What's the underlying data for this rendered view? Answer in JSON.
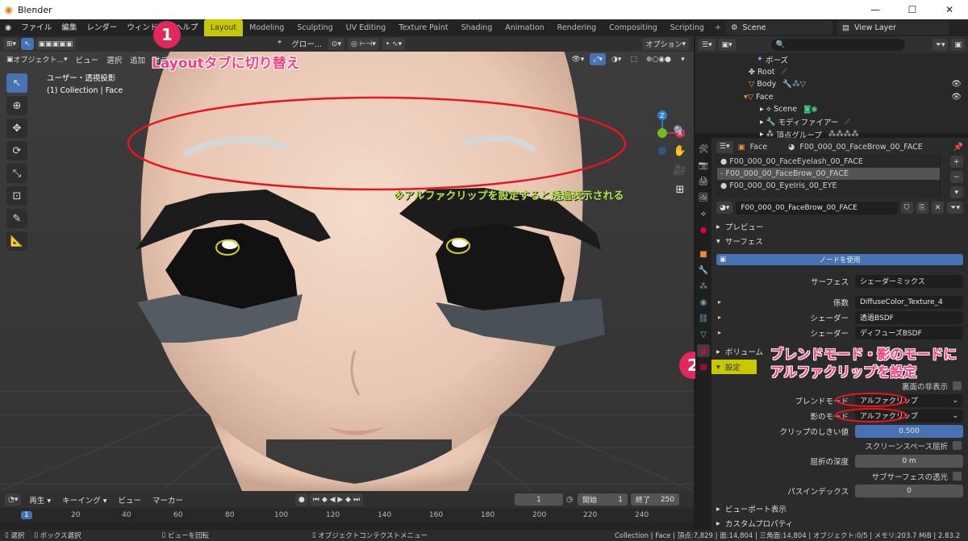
{
  "window": {
    "title": "Blender",
    "min": "—",
    "max": "☐",
    "close": "✕"
  },
  "menu": [
    "ファイル",
    "編集",
    "レンダー",
    "ウィンドウ",
    "ヘルプ"
  ],
  "workspaces": [
    "Layout",
    "Modeling",
    "Sculpting",
    "UV Editing",
    "Texture Paint",
    "Shading",
    "Animation",
    "Rendering",
    "Compositing",
    "Scripting"
  ],
  "scene": {
    "name": "Scene",
    "view_layer": "View Layer"
  },
  "viewport": {
    "header": {
      "mode": "オブジェクト...",
      "view": "ビュー",
      "select": "選択",
      "add": "追加",
      "object": "オブジェクト"
    },
    "header2": {
      "transform": "グロー...",
      "options": "オプション"
    },
    "info_line1": "ユーザー・透視投影",
    "info_line2": "(1) Collection | Face",
    "gizmo": {
      "z": "Z",
      "x": "X",
      "y": "Y"
    }
  },
  "annotations": {
    "step1_num": "1",
    "step1_text": "Layoutタブに切り替え",
    "note": "※アルファクリップを設定すると透過表示される",
    "step2_num": "2",
    "step2_line1": "ブレンドモード・影のモードに",
    "step2_line2": "アルファクリップを設定"
  },
  "outliner": {
    "rows": [
      {
        "label": "ポーズ",
        "indent": 5
      },
      {
        "label": "Root",
        "indent": 4
      },
      {
        "label": "Body",
        "indent": 4
      },
      {
        "label": "Face",
        "indent": 4
      },
      {
        "label": "Scene",
        "indent": 5
      },
      {
        "label": "モディファイアー",
        "indent": 5
      },
      {
        "label": "頂点グループ",
        "indent": 5
      }
    ]
  },
  "properties": {
    "object": "Face",
    "material_name": "F00_000_00_FaceBrow_00_FACE",
    "slots": [
      "F00_000_00_FaceEyelash_00_FACE",
      "F00_000_00_FaceBrow_00_FACE",
      "F00_000_00_EyeIris_00_EYE"
    ],
    "material_field": "F00_000_00_FaceBrow_00_FACE",
    "preview": "プレビュー",
    "surface": "サーフェス",
    "use_nodes": "ノードを使用",
    "rows": {
      "surface_label": "サーフェス",
      "surface_val": "シェーダーミックス",
      "fac_label": "係数",
      "fac_val": "DiffuseColor_Texture_4",
      "shader1_label": "シェーダー",
      "shader1_val": "透過BSDF",
      "shader2_label": "シェーダー",
      "shader2_val": "ディフューズBSDF"
    },
    "volume": "ボリューム",
    "settings": "設定",
    "backface": "裏面の非表示",
    "blend_label": "ブレンドモード",
    "blend_val": "アルファクリップ",
    "shadow_label": "影のモード",
    "shadow_val": "アルファクリップ",
    "clip_label": "クリップのしきい値",
    "clip_val": "0.500",
    "ssr": "スクリーンスペース屈折",
    "refr_label": "屈折の深度",
    "refr_val": "0 m",
    "sss": "サブサーフェスの透光",
    "pass_label": "パスインデックス",
    "pass_val": "0",
    "viewport_display": "ビューポート表示",
    "custom_props": "カスタムプロパティ"
  },
  "timeline": {
    "playback": "再生",
    "keying": "キーイング",
    "view": "ビュー",
    "marker": "マーカー",
    "current": "1",
    "start_label": "開始",
    "start": "1",
    "end_label": "終了",
    "end": "250",
    "ruler": [
      "1",
      "20",
      "40",
      "60",
      "80",
      "100",
      "120",
      "140",
      "160",
      "180",
      "200",
      "220",
      "240"
    ]
  },
  "status": {
    "select": "選択",
    "box": "ボックス選択",
    "rotate": "ビューを回転",
    "context": "オブジェクトコンテクストメニュー",
    "stats": "Collection | Face | 頂点:7,829 | 面:14,804 | 三角面:14,804 | オブジェクト:0/5 | メモリ:203.7 MiB | 2.83.2"
  },
  "colors": {
    "accent": "#4772b3",
    "annotation": "#e0285a",
    "highlight": "#c8c800"
  }
}
